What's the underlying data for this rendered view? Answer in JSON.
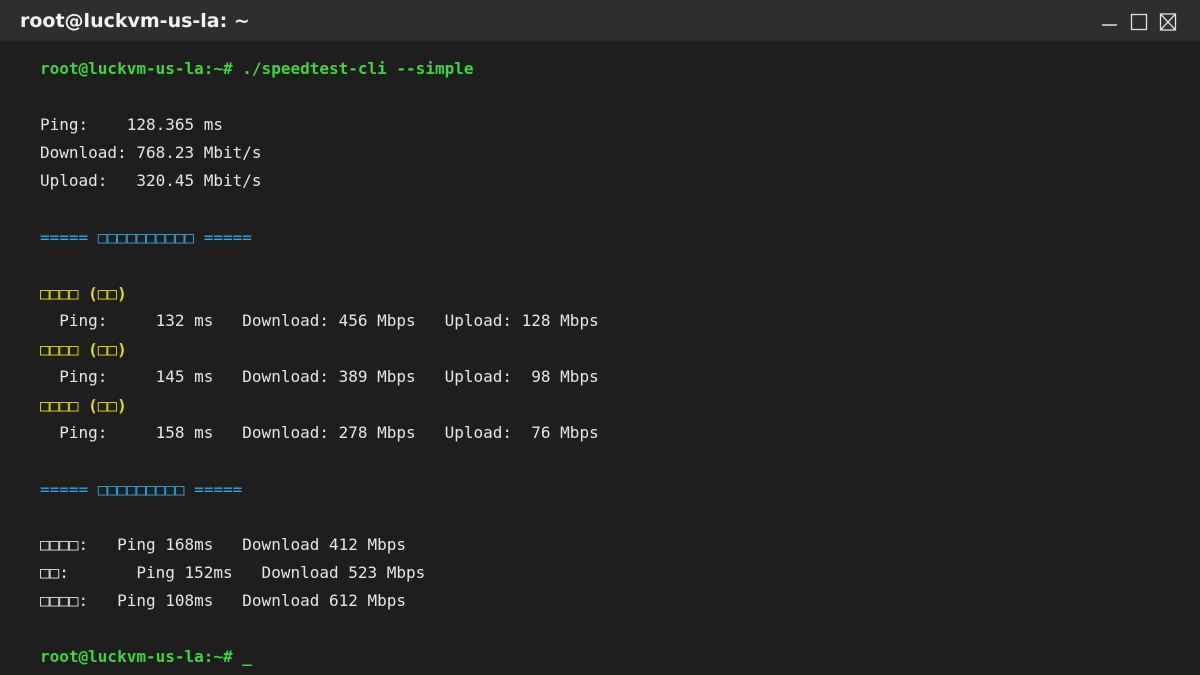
{
  "window": {
    "title": "root@luckvm-us-la: ~",
    "controls": {
      "minimize_icon": "minimize-icon",
      "maximize_icon": "maximize-icon",
      "close_icon": "close-icon"
    }
  },
  "terminal": {
    "prompt": "root@luckvm-us-la:~#",
    "command": " ./speedtest-cli --simple",
    "results": {
      "ping": "Ping:    128.365 ms",
      "download": "Download: 768.23 Mbit/s",
      "upload": "Upload:   320.45 Mbit/s"
    },
    "section1_header": "===== □□□□□□□□□□ =====",
    "locations": [
      {
        "name": "□□□□ (□□)",
        "stats": "  Ping:     132 ms   Download: 456 Mbps   Upload: 128 Mbps"
      },
      {
        "name": "□□□□ (□□)",
        "stats": "  Ping:     145 ms   Download: 389 Mbps   Upload:  98 Mbps"
      },
      {
        "name": "□□□□ (□□)",
        "stats": "  Ping:     158 ms   Download: 278 Mbps   Upload:  76 Mbps"
      }
    ],
    "section2_header": "===== □□□□□□□□□ =====",
    "isp_results": [
      "□□□□:   Ping 168ms   Download 412 Mbps",
      "□□:       Ping 152ms   Download 523 Mbps",
      "□□□□:   Ping 108ms   Download 612 Mbps"
    ],
    "final_prompt": "root@luckvm-us-la:~#",
    "cursor": " _"
  },
  "colors": {
    "background": "#1e1e1e",
    "titlebar": "#2e2e2e",
    "prompt_green": "#3ed53e",
    "section_blue": "#33a7e8",
    "location_yellow": "#e6e200",
    "text": "#e6e6e6"
  }
}
